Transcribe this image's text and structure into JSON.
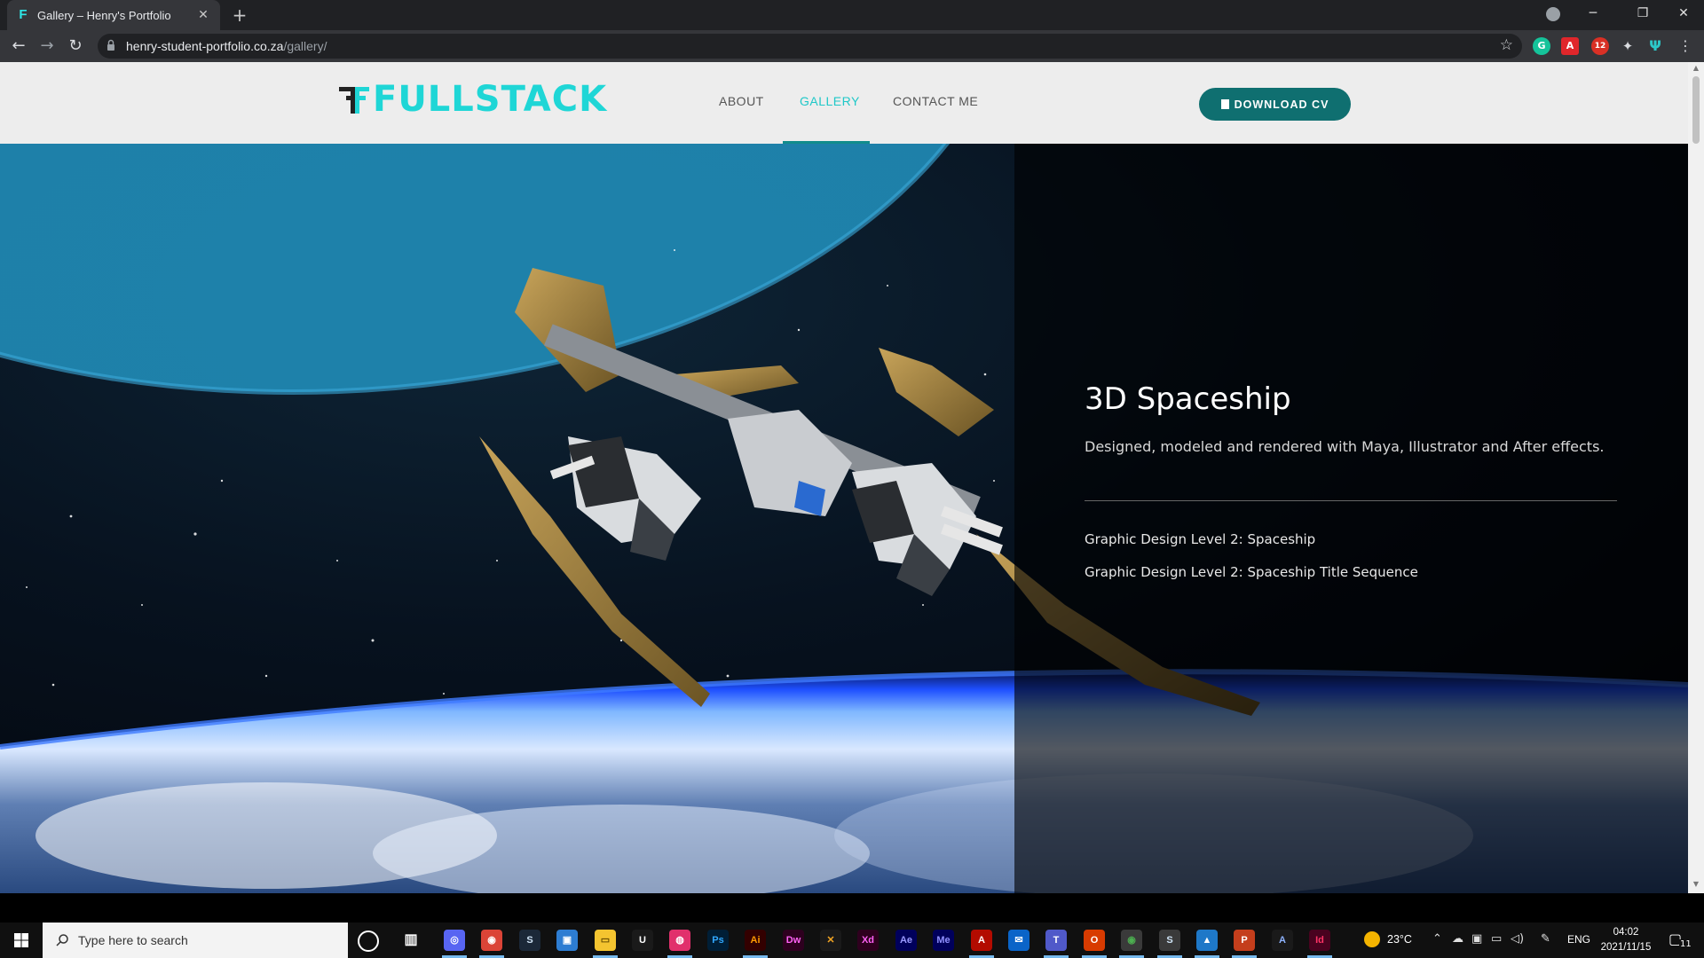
{
  "browser": {
    "tab_title": "Gallery – Henry's Portfolio",
    "tab_favicon": "F",
    "tab_close": "✕",
    "new_tab": "+",
    "url_host": "henry-student-portfolio.co.za",
    "url_path": "/gallery/",
    "window_controls": {
      "minimize": "─",
      "restore": "❐",
      "close": "✕"
    },
    "nav": {
      "back": "←",
      "forward": "→",
      "reload": "↻",
      "star": "☆",
      "menu": "⋮"
    },
    "extensions": [
      {
        "name": "grammarly-extension-icon",
        "label": "G",
        "color": "#15c39a"
      },
      {
        "name": "acrobat-extension-icon",
        "label": "A",
        "color": "#e0262b"
      },
      {
        "name": "adblock-extension-icon",
        "label": "12",
        "color": "#d93025"
      },
      {
        "name": "extensions-puzzle-icon",
        "label": "✦",
        "color": "#5f6368"
      },
      {
        "name": "profile-extension-icon",
        "label": "Ψ",
        "color": "#1a7f85"
      }
    ]
  },
  "site": {
    "logo_text": "FULLSTACK",
    "nav": {
      "about": "ABOUT",
      "gallery": "GALLERY",
      "contact": "CONTACT ME"
    },
    "download_cv": "DOWNLOAD CV",
    "accent": "#1fd6d6",
    "button_color": "#0f6f70"
  },
  "hero": {
    "title": "3D Spaceship",
    "description": "Designed, modeled and rendered with Maya, Illustrator and After effects.",
    "links": [
      "Graphic Design Level 2: Spaceship",
      "Graphic Design Level 2: Spaceship Title Sequence"
    ]
  },
  "taskbar": {
    "search_placeholder": "Type here to search",
    "apps": [
      {
        "name": "discord-icon",
        "label": "◎",
        "bg": "#5865f2",
        "fg": "#fff"
      },
      {
        "name": "chrome-icon",
        "label": "◉",
        "bg": "#db4437",
        "fg": "#fff"
      },
      {
        "name": "steam-icon",
        "label": "S",
        "bg": "#1b2838",
        "fg": "#cfe3f5"
      },
      {
        "name": "folder-blue-icon",
        "label": "▣",
        "bg": "#2d7dd2",
        "fg": "#fff"
      },
      {
        "name": "file-explorer-icon",
        "label": "▭",
        "bg": "#f4c430",
        "fg": "#6b4f00"
      },
      {
        "name": "ubisoft-icon",
        "label": "U",
        "bg": "#1a1a1a",
        "fg": "#fff"
      },
      {
        "name": "gallery-app-icon",
        "label": "◍",
        "bg": "#e1306c",
        "fg": "#fff"
      },
      {
        "name": "photoshop-icon",
        "label": "Ps",
        "bg": "#001e36",
        "fg": "#31a8ff"
      },
      {
        "name": "illustrator-icon",
        "label": "Ai",
        "bg": "#330000",
        "fg": "#ff9a00"
      },
      {
        "name": "dreamweaver-icon",
        "label": "Dw",
        "bg": "#2e001f",
        "fg": "#ff61f6"
      },
      {
        "name": "app-x-icon",
        "label": "✕",
        "bg": "#1a1a1a",
        "fg": "#f5a623"
      },
      {
        "name": "xd-icon",
        "label": "Xd",
        "bg": "#2e001e",
        "fg": "#ff61f6"
      },
      {
        "name": "after-effects-icon",
        "label": "Ae",
        "bg": "#00005b",
        "fg": "#9999ff"
      },
      {
        "name": "media-encoder-icon",
        "label": "Me",
        "bg": "#00005b",
        "fg": "#8f8fff"
      },
      {
        "name": "acrobat-icon",
        "label": "A",
        "bg": "#b30b00",
        "fg": "#fff"
      },
      {
        "name": "mail-icon",
        "label": "✉",
        "bg": "#0a64c8",
        "fg": "#fff"
      },
      {
        "name": "teams-icon",
        "label": "T",
        "bg": "#5059c9",
        "fg": "#fff"
      },
      {
        "name": "office-icon",
        "label": "O",
        "bg": "#d83b01",
        "fg": "#fff"
      },
      {
        "name": "chrome-active-icon",
        "label": "◉",
        "bg": "#3a3a3a",
        "fg": "#4caf50"
      },
      {
        "name": "steam-active-icon",
        "label": "S",
        "bg": "#3a3a3a",
        "fg": "#cfe3f5"
      },
      {
        "name": "photos-icon",
        "label": "▲",
        "bg": "#1e78c8",
        "fg": "#fff"
      },
      {
        "name": "powerpoint-icon",
        "label": "P",
        "bg": "#c43e1c",
        "fg": "#fff"
      },
      {
        "name": "app-a-icon",
        "label": "A",
        "bg": "#1a1a1a",
        "fg": "#8fb4ff"
      },
      {
        "name": "indesign-icon",
        "label": "Id",
        "bg": "#49021f",
        "fg": "#ff3366"
      }
    ],
    "weather": "23°C",
    "lang": "ENG",
    "time": "04:02",
    "date": "2021/11/15",
    "notifications": "11"
  }
}
